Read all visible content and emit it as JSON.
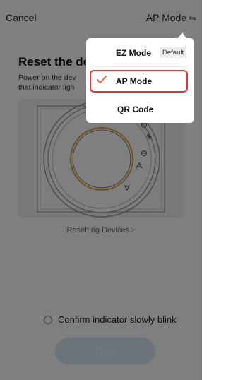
{
  "header": {
    "cancel_label": "Cancel",
    "mode_label": "AP Mode",
    "swap_icon": "⇋"
  },
  "main": {
    "title": "Reset the de",
    "desc_line1": "Power on the dev",
    "desc_line2": "that indicator ligh",
    "resetting_link": "Resetting Devices",
    "resetting_chevron": ">",
    "confirm_label": "Confirm indicator slowly blink",
    "next_label": "Next"
  },
  "device_icons": [
    "power-icon",
    "fan-icon",
    "clock-icon",
    "mode-icon",
    "temperature-icon"
  ],
  "popup": {
    "items": [
      {
        "label": "EZ Mode",
        "badge": "Default",
        "selected": false
      },
      {
        "label": "AP Mode",
        "badge": "",
        "selected": true
      },
      {
        "label": "QR Code",
        "badge": "",
        "selected": false
      }
    ]
  },
  "colors": {
    "accent_check": "#e8643c",
    "highlight_border": "#d33a3a",
    "dial_ring": "#e0a84a",
    "next_button": "#d8e6f6"
  }
}
